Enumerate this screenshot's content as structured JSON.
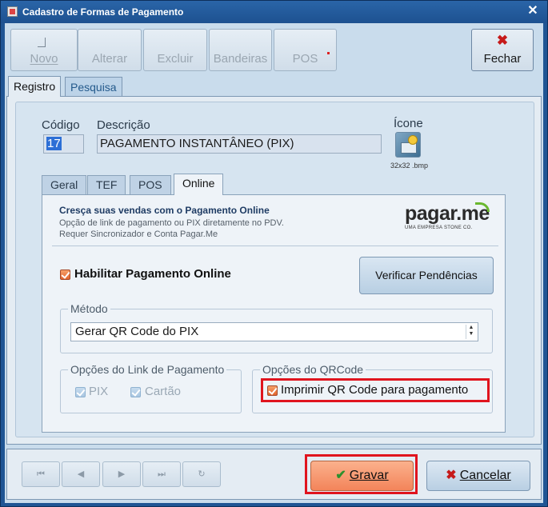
{
  "window": {
    "title": "Cadastro de Formas de Pagamento",
    "close_glyph": "✕"
  },
  "toolbar": {
    "novo": "Novo",
    "alterar": "Alterar",
    "excluir": "Excluir",
    "bandeiras": "Bandeiras",
    "pos": "POS",
    "fechar": "Fechar"
  },
  "main_tabs": [
    "Registro",
    "Pesquisa"
  ],
  "form": {
    "codigo_label": "Código",
    "codigo_value": "17",
    "descricao_label": "Descrição",
    "descricao_value": "PAGAMENTO INSTANTÂNEO (PIX)",
    "icone_label": "Ícone",
    "icone_caption": "32x32 .bmp"
  },
  "sub_tabs": [
    "Geral",
    "TEF",
    "POS",
    "Online"
  ],
  "online": {
    "promo_title": "Cresça suas vendas com o Pagamento Online",
    "promo_line1": "Opção de link de pagamento ou PIX diretamente no PDV.",
    "promo_line2": "Requer Sincronizador e Conta Pagar.Me",
    "logo_word": "pagar.me",
    "logo_tag": "UMA EMPRESA STONE CO.",
    "habilitar_label": "Habilitar Pagamento Online",
    "verificar_label": "Verificar Pendências",
    "metodo_title": "Método",
    "metodo_value": "Gerar QR Code do PIX",
    "link_group_title": "Opções do Link de Pagamento",
    "pix_label": "PIX",
    "cartao_label": "Cartão",
    "qr_group_title": "Opções do QRCode",
    "imprimir_label": "Imprimir QR Code para pagamento"
  },
  "nav": [
    "⏮",
    "◀",
    "▶",
    "⏭",
    "↻"
  ],
  "actions": {
    "gravar": "Gravar",
    "cancelar": "Cancelar"
  },
  "colors": {
    "title_bar": "#1f5594",
    "highlight": "#e0141e",
    "gravar_button": "#f3845a",
    "checkbox": "#e2642c"
  }
}
